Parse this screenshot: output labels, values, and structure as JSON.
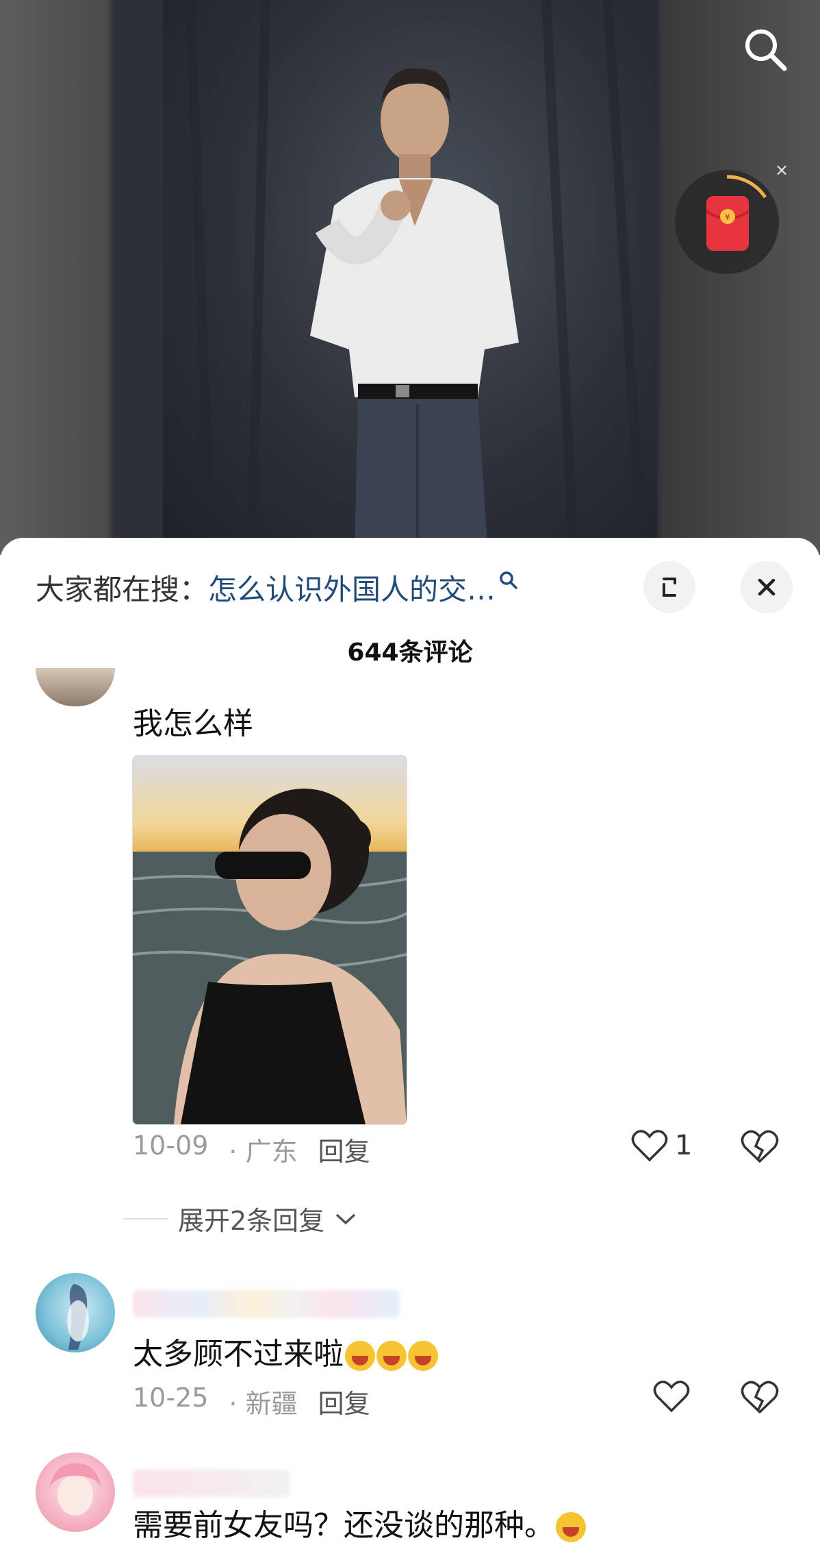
{
  "hot_search": {
    "prefix": "大家都在搜：",
    "query": "怎么认识外国人的交…"
  },
  "comments_header": {
    "count_label": "644条评论"
  },
  "comments": [
    {
      "text": "我怎么样",
      "has_image": true,
      "date": "10-09",
      "location": "· 广东",
      "reply_label": "回复",
      "likes": "1"
    },
    {
      "text": "太多顾不过来啦",
      "emojis": [
        "cry-laugh-emoji",
        "cry-laugh-emoji",
        "cry-laugh-emoji"
      ],
      "date": "10-25",
      "location": "· 新疆",
      "reply_label": "回复",
      "likes": ""
    },
    {
      "text": "需要前女友吗？还没谈的那种。",
      "emojis": [
        "smirk-emoji"
      ]
    }
  ],
  "expand_replies": {
    "label": "展开2条回复"
  },
  "colors": {
    "link_blue": "#1f4a7a",
    "muted_gray": "#9a9a9a",
    "redpacket_red": "#e8343f"
  }
}
